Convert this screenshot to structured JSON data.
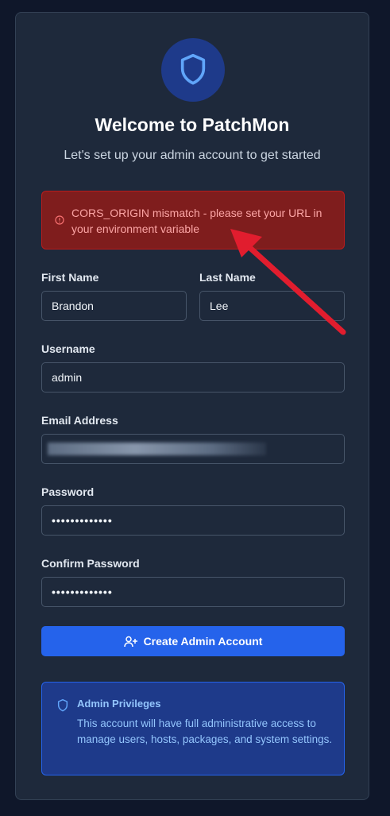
{
  "header": {
    "title": "Welcome to PatchMon",
    "subtitle": "Let's set up your admin account to get started"
  },
  "alert": {
    "message": "CORS_ORIGIN mismatch - please set your URL in your environment variable"
  },
  "form": {
    "first_name": {
      "label": "First Name",
      "value": "Brandon"
    },
    "last_name": {
      "label": "Last Name",
      "value": "Lee"
    },
    "username": {
      "label": "Username",
      "value": "admin"
    },
    "email": {
      "label": "Email Address",
      "value": ""
    },
    "password": {
      "label": "Password",
      "value": "•••••••••••••"
    },
    "confirm_password": {
      "label": "Confirm Password",
      "value": "•••••••••••••"
    },
    "submit_label": "Create Admin Account"
  },
  "info": {
    "title": "Admin Privileges",
    "text": "This account will have full administrative access to manage users, hosts, packages, and system settings."
  },
  "colors": {
    "accent": "#2563eb",
    "alert_bg": "#7f1d1d",
    "alert_text": "#fca5a5",
    "annotation_arrow": "#e11d2e"
  },
  "icons": {
    "logo": "shield-icon",
    "alert": "alert-circle-icon",
    "button": "user-plus-icon",
    "info": "shield-icon"
  }
}
